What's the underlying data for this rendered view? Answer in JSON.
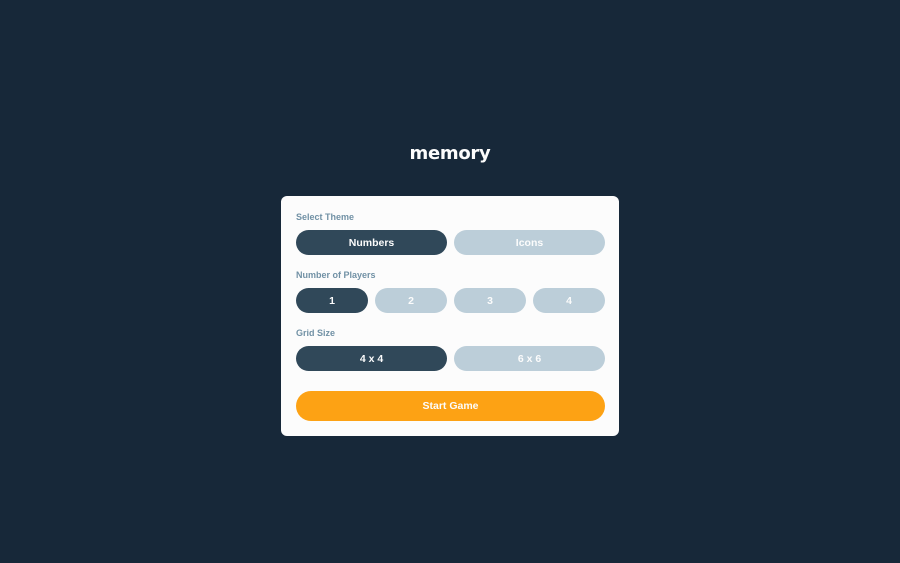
{
  "app": {
    "logo": "memory"
  },
  "settings": {
    "theme": {
      "label": "Select Theme",
      "options": [
        "Numbers",
        "Icons"
      ],
      "selected": "Numbers"
    },
    "players": {
      "label": "Number of Players",
      "options": [
        "1",
        "2",
        "3",
        "4"
      ],
      "selected": "1"
    },
    "grid": {
      "label": "Grid Size",
      "options": [
        "4 x 4",
        "6 x 6"
      ],
      "selected": "4 x 4"
    },
    "start_label": "Start Game"
  },
  "colors": {
    "background": "#172839",
    "card": "#FCFCFC",
    "label": "#7191A5",
    "option_active": "#304859",
    "option_inactive": "#BCCED9",
    "start_button": "#FDA214"
  }
}
